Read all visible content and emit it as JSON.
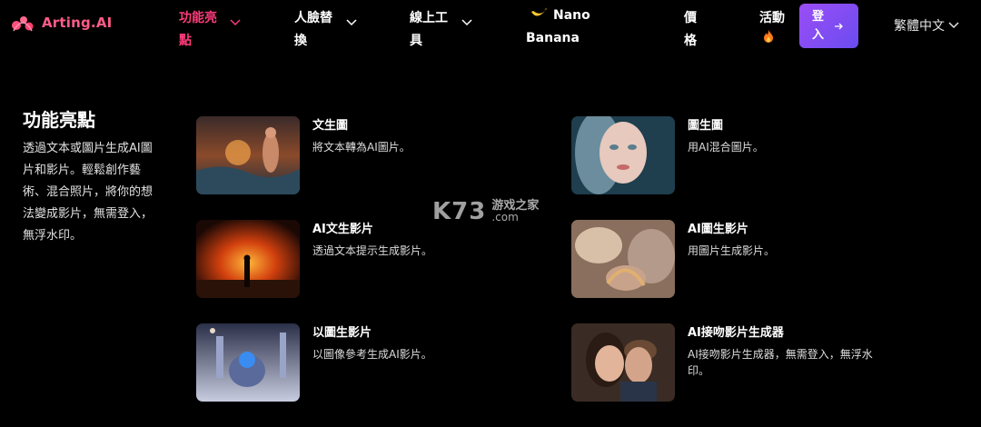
{
  "header": {
    "logo_text": "Arting.AI",
    "nav": [
      {
        "label": "功能亮點",
        "active": true
      },
      {
        "label": "人臉替換"
      },
      {
        "label": "線上工具"
      },
      {
        "label": "Nano Banana",
        "icon": "banana-icon"
      },
      {
        "label": "價格"
      },
      {
        "label": "活動",
        "icon": "fire-icon"
      }
    ],
    "login_label": "登入",
    "language": "繁體中文"
  },
  "section": {
    "title": "功能亮點",
    "description": "透過文本或圖片生成AI圖片和影片。輕鬆創作藝術、混合照片，將你的想法變成影片，無需登入，無浮水印。"
  },
  "cards": [
    {
      "title": "文生圖",
      "desc": "將文本轉為AI圖片。"
    },
    {
      "title": "圖生圖",
      "desc": "用AI混合圖片。"
    },
    {
      "title": "AI文生影片",
      "desc": "透過文本提示生成影片。"
    },
    {
      "title": "AI圖生影片",
      "desc": "用圖片生成影片。"
    },
    {
      "title": "以圖生影片",
      "desc": "以圖像參考生成AI影片。"
    },
    {
      "title": "AI接吻影片生成器",
      "desc": "AI接吻影片生成器，無需登入，無浮水印。"
    }
  ],
  "watermark": {
    "brand": "K73",
    "name": "游戏之家",
    "domain": ".com"
  },
  "colors": {
    "accent": "#ff3b7b",
    "button_start": "#9b4df5",
    "button_end": "#6a4df0",
    "background": "#000000"
  }
}
